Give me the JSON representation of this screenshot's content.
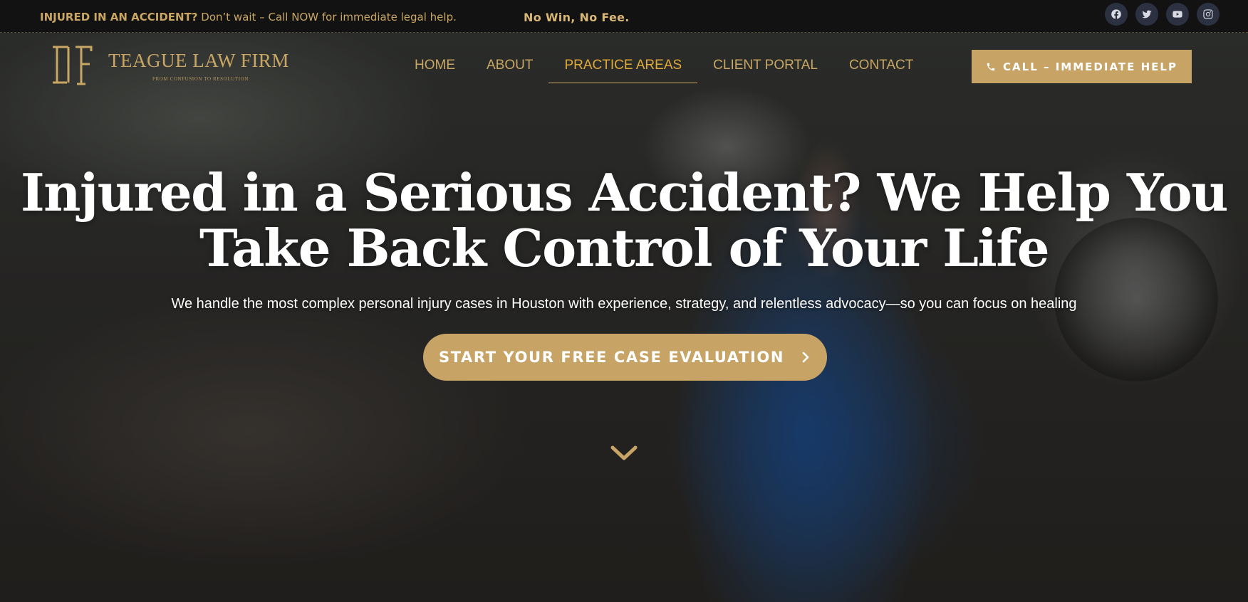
{
  "topbar": {
    "alert_strong": "INJURED IN AN ACCIDENT?",
    "alert_rest": " Don’t wait – Call NOW for immediate legal help.",
    "no_win": "No Win, No Fee.",
    "socials": [
      "facebook-icon",
      "twitter-icon",
      "youtube-icon",
      "instagram-icon"
    ]
  },
  "logo": {
    "monogram": "LTF",
    "name": "TEAGUE LAW FIRM",
    "tagline": "FROM CONFUSION TO RESOLUTION"
  },
  "nav": {
    "items": [
      {
        "label": "HOME"
      },
      {
        "label": "ABOUT"
      },
      {
        "label": "PRACTICE AREAS",
        "active": true
      },
      {
        "label": "CLIENT PORTAL"
      },
      {
        "label": "CONTACT"
      }
    ],
    "call_label": "CALL – IMMEDIATE HELP",
    "call_icon": "phone-icon"
  },
  "hero": {
    "headline_line1": "Injured in a Serious Accident? We Help You",
    "headline_line2": "Take Back Control of Your Life",
    "subhead": "We handle the most complex personal injury cases in Houston with experience, strategy, and relentless advocacy—so you can focus on healing",
    "cta_label": "START YOUR FREE CASE EVALUATION",
    "cta_icon": "chevron-right-icon",
    "scroll_icon": "chevron-down-icon"
  },
  "colors": {
    "gold": "#c7a466",
    "gold_text": "#c9a663",
    "active_nav": "#e0a93a",
    "topbar_bg": "#121212",
    "social_bg": "#2b3140"
  }
}
